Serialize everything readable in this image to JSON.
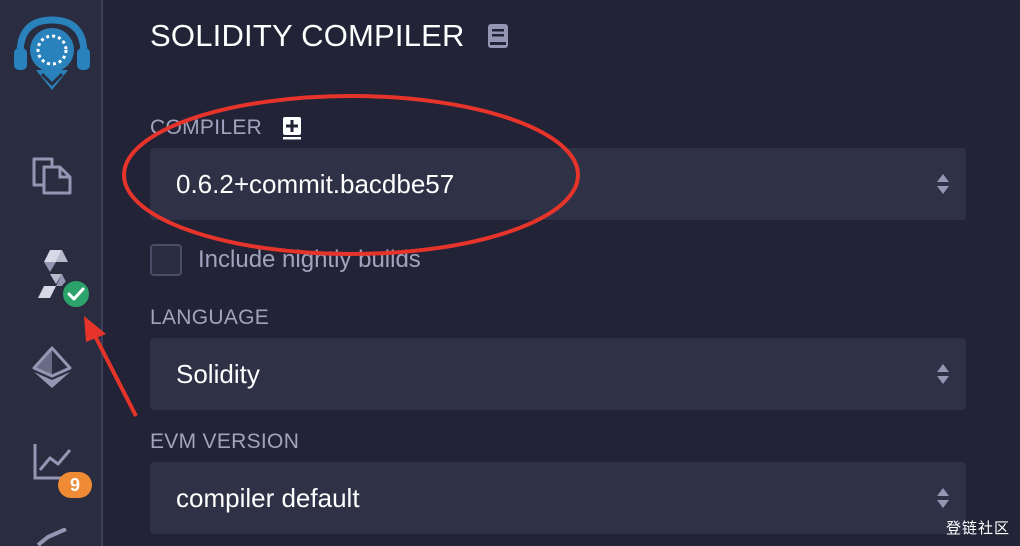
{
  "theme": {
    "background": "#222336",
    "rail_background": "#2a2c3f",
    "select_background": "#2f3146",
    "label_color": "#a2a3bd",
    "icon_color": "#9496b3",
    "logo_color": "#2a82bd",
    "success_color": "#2ca36b",
    "warning_color": "#ef8a35",
    "annotation_color": "#e6342a"
  },
  "sidebar": {
    "items": [
      {
        "name": "remix-logo",
        "icon": "remix-logo-icon"
      },
      {
        "name": "file-explorer",
        "icon": "files-icon"
      },
      {
        "name": "solidity-compiler",
        "icon": "solidity-icon",
        "status": "compiled-success"
      },
      {
        "name": "deploy-run",
        "icon": "ethereum-icon"
      },
      {
        "name": "solidity-analysis",
        "icon": "chart-line-icon",
        "badge": "9"
      },
      {
        "name": "more",
        "icon": "check-icon"
      }
    ]
  },
  "panel": {
    "title": "SOLIDITY COMPILER",
    "doc_icon": "book-icon",
    "compiler": {
      "label": "COMPILER",
      "add_icon": "plus-square-icon",
      "selected": "0.6.2+commit.bacdbe57"
    },
    "nightly": {
      "label": "Include nightly builds",
      "checked": false
    },
    "language": {
      "label": "LANGUAGE",
      "selected": "Solidity"
    },
    "evm_version": {
      "label": "EVM VERSION",
      "selected": "compiler default"
    }
  },
  "watermark": "登链社区"
}
